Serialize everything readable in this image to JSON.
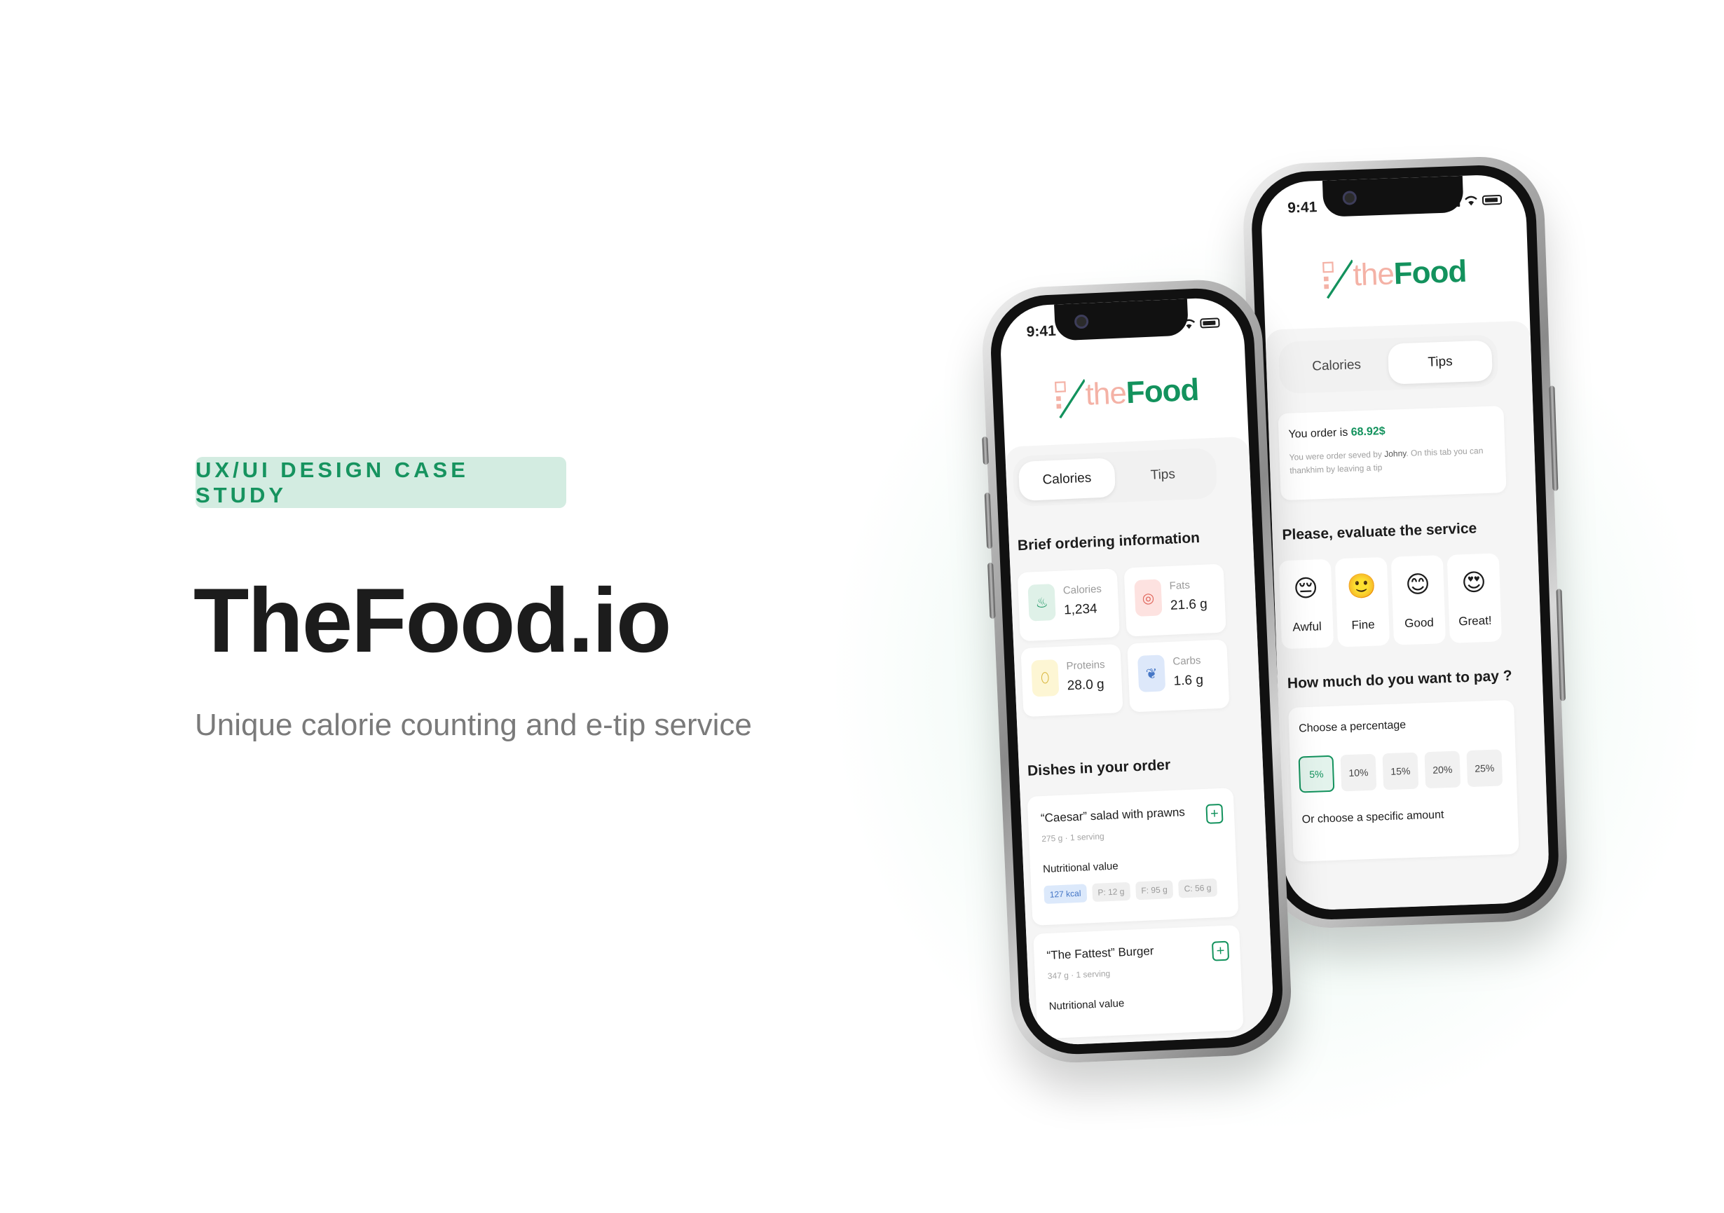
{
  "hero": {
    "tag": "UX/UI DESIGN CASE STUDY",
    "title": "TheFood.io",
    "subtitle": "Unique calorie counting and e-tip service"
  },
  "colors": {
    "brand_green": "#13925d",
    "tag_bg": "#d3ece1",
    "logo_the": "#f4b2a6"
  },
  "phone_front": {
    "time": "9:41",
    "logo_the": "the",
    "logo_food": "Food",
    "tabs": [
      "Calories",
      "Tips"
    ],
    "active_tab": "Calories",
    "brief_title": "Brief ordering information",
    "stats": [
      {
        "label": "Calories",
        "value": "1,234",
        "icon": "flame-icon"
      },
      {
        "label": "Fats",
        "value": "21.6 g",
        "icon": "donut-icon"
      },
      {
        "label": "Proteins",
        "value": "28.0 g",
        "icon": "egg-icon"
      },
      {
        "label": "Carbs",
        "value": "1.6 g",
        "icon": "wheat-icon"
      }
    ],
    "dishes_title": "Dishes in your order",
    "dishes": [
      {
        "name": "“Caesar” salad with prawns",
        "meta": "275 g · 1 serving",
        "nutrition_label": "Nutritional value",
        "chips": [
          "127 kcal",
          "P: 12 g",
          "F: 95 g",
          "C: 56 g"
        ]
      },
      {
        "name": "“The Fattest” Burger",
        "meta": "347 g · 1 serving",
        "nutrition_label": "Nutritional value"
      }
    ]
  },
  "phone_back": {
    "time": "9:41",
    "logo_the": "the",
    "logo_food": "Food",
    "tabs": [
      "Calories",
      "Tips"
    ],
    "active_tab": "Tips",
    "order_label": "You order is",
    "order_amount": "68.92$",
    "order_desc_1": "You were order seved by",
    "order_waiter": "Johny",
    "order_desc_2": ". On this tab you can thankhim by leaving a tip",
    "evaluate_title": "Please, evaluate the service",
    "ratings": [
      {
        "label": "Awful",
        "emoji": "😔"
      },
      {
        "label": "Fine",
        "emoji": "🙂"
      },
      {
        "label": "Good",
        "emoji": "😊"
      },
      {
        "label": "Great!",
        "emoji": "😍"
      }
    ],
    "pay_title": "How much do you want to pay ?",
    "percent_label": "Choose a percentage",
    "percents": [
      "5%",
      "10%",
      "15%",
      "20%",
      "25%"
    ],
    "selected_percent": "5%",
    "amount_label": "Or choose a specific amount"
  }
}
